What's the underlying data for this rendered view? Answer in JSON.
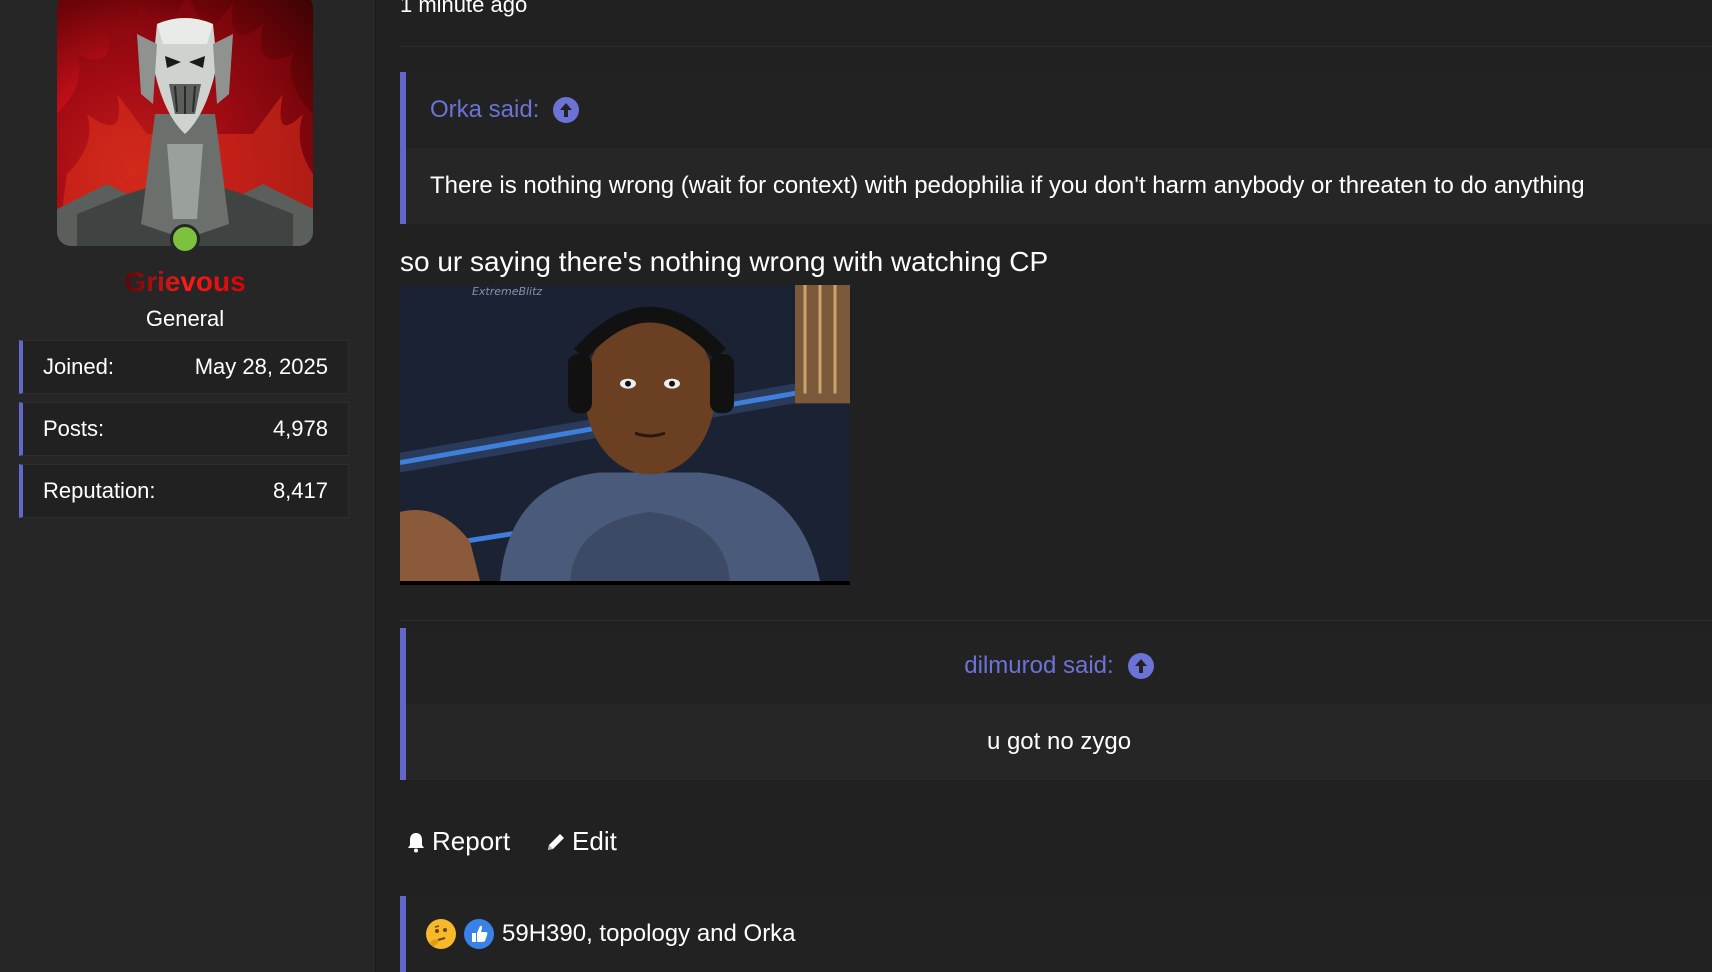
{
  "user": {
    "name": "Grievous",
    "title": "General",
    "stats": [
      {
        "label": "Joined:",
        "value": "May 28, 2025"
      },
      {
        "label": "Posts:",
        "value": "4,978"
      },
      {
        "label": "Reputation:",
        "value": "8,417"
      }
    ],
    "online": true
  },
  "post": {
    "time": "1 minute ago",
    "quotes": [
      {
        "author_line": "Orka said:",
        "text": "There is nothing wrong (wait for context) with pedophilia if you don't harm anybody or threaten to do anything"
      },
      {
        "author_line": "dilmurod said:",
        "text": "u got no zygo"
      }
    ],
    "body_text": "so ur saying there's nothing wrong with watching CP",
    "gif_watermark": "ExtremeBlitz"
  },
  "actions": {
    "report_label": "Report",
    "edit_label": "Edit"
  },
  "reactions": {
    "icons": [
      "thinking-emoji-icon",
      "like-icon"
    ],
    "text": "59H390, topology and Orka"
  },
  "colors": {
    "accent": "#6168c9",
    "quote_link": "#6b73d6",
    "background": "#212121",
    "sidebar": "#262626",
    "online": "#7cc23d"
  }
}
